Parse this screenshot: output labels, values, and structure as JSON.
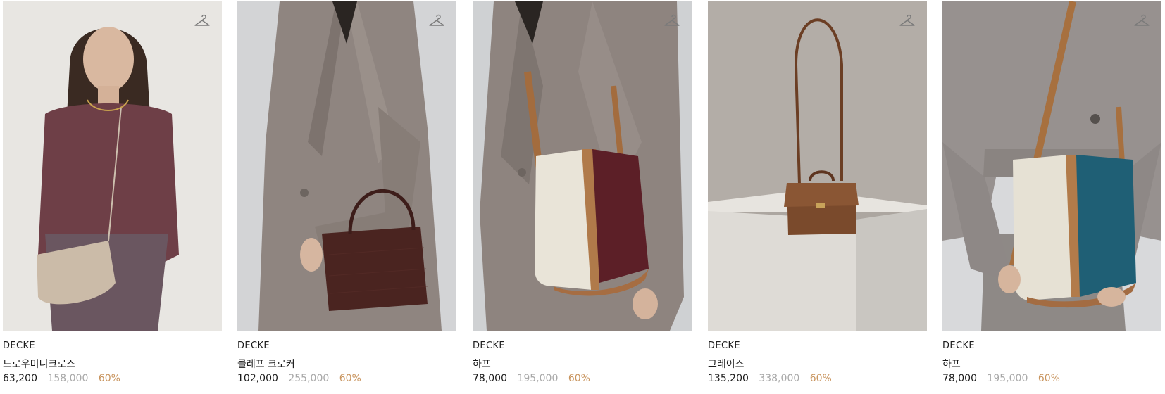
{
  "products": [
    {
      "brand": "DECKE",
      "name": "드로우미니크로스",
      "price": "63,200",
      "original_price": "158,000",
      "discount": "60%"
    },
    {
      "brand": "DECKE",
      "name": "클레프 크로커",
      "price": "102,000",
      "original_price": "255,000",
      "discount": "60%"
    },
    {
      "brand": "DECKE",
      "name": "하프",
      "price": "78,000",
      "original_price": "195,000",
      "discount": "60%"
    },
    {
      "brand": "DECKE",
      "name": "그레이스",
      "price": "135,200",
      "original_price": "338,000",
      "discount": "60%"
    },
    {
      "brand": "DECKE",
      "name": "하프",
      "price": "78,000",
      "original_price": "195,000",
      "discount": "60%"
    }
  ],
  "icons": {
    "wishlist": "hanger-icon"
  },
  "colors": {
    "discount": "#c9955f",
    "original_price": "#a8a8a8",
    "text": "#1c1c1c"
  }
}
